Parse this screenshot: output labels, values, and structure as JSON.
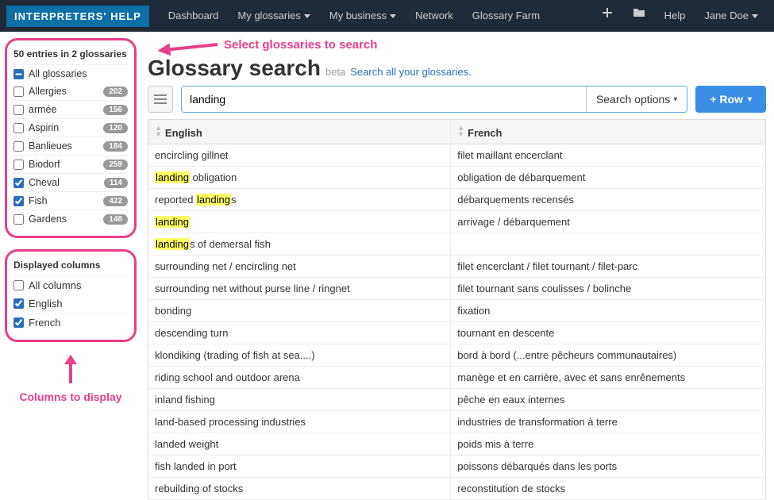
{
  "brand": "INTERPRETERS' HELP",
  "nav": {
    "dashboard": "Dashboard",
    "my_glossaries": "My glossaries",
    "my_business": "My business",
    "network": "Network",
    "glossary_farm": "Glossary Farm",
    "help": "Help",
    "user": "Jane Doe"
  },
  "annotations": {
    "select_glossaries": "Select glossaries to search",
    "columns_to_display": "Columns to display"
  },
  "sidebar": {
    "entries_head": "50 entries in 2 glossaries",
    "all_glossaries": "All glossaries",
    "glossaries": [
      {
        "label": "Allergies",
        "count": "202",
        "checked": false
      },
      {
        "label": "armée",
        "count": "156",
        "checked": false
      },
      {
        "label": "Aspirin",
        "count": "120",
        "checked": false
      },
      {
        "label": "Banlieues",
        "count": "184",
        "checked": false
      },
      {
        "label": "Biodorf",
        "count": "259",
        "checked": false
      },
      {
        "label": "Cheval",
        "count": "114",
        "checked": true
      },
      {
        "label": "Fish",
        "count": "422",
        "checked": true
      },
      {
        "label": "Gardens",
        "count": "148",
        "checked": false
      }
    ],
    "columns_head": "Displayed columns",
    "all_columns": "All columns",
    "columns": [
      {
        "label": "English",
        "checked": true
      },
      {
        "label": "French",
        "checked": true
      }
    ]
  },
  "main": {
    "title": "Glossary search",
    "beta": "beta",
    "title_link": "Search all your glossaries.",
    "search_value": "landing",
    "search_options": "Search options",
    "row_btn": "+ Row",
    "col_english": "English",
    "col_french": "French",
    "rows": [
      {
        "en_pre": "encircling gillnet",
        "en_hl": "",
        "en_post": "",
        "fr": "filet maillant encerclant"
      },
      {
        "en_pre": "",
        "en_hl": "landing",
        "en_post": " obligation",
        "fr": "obligation de débarquement"
      },
      {
        "en_pre": "reported ",
        "en_hl": "landing",
        "en_post": "s",
        "fr": "débarquements recensés"
      },
      {
        "en_pre": "",
        "en_hl": "landing",
        "en_post": "",
        "fr": "arrivage / débarquement"
      },
      {
        "en_pre": "",
        "en_hl": "landing",
        "en_post": "s of demersal fish",
        "fr": ""
      },
      {
        "en_pre": "surrounding net / encircling net",
        "en_hl": "",
        "en_post": "",
        "fr": "filet encerclant / filet tournant / filet-parc"
      },
      {
        "en_pre": "surrounding net without purse line / ringnet",
        "en_hl": "",
        "en_post": "",
        "fr": "filet tournant sans coulisses / bolinche"
      },
      {
        "en_pre": "bonding",
        "en_hl": "",
        "en_post": "",
        "fr": "fixation"
      },
      {
        "en_pre": "descending turn",
        "en_hl": "",
        "en_post": "",
        "fr": "tournant en descente"
      },
      {
        "en_pre": "klondiking (trading of fish at sea....)",
        "en_hl": "",
        "en_post": "",
        "fr": "bord à bord (...entre pêcheurs communautaires)"
      },
      {
        "en_pre": "riding school and outdoor arena",
        "en_hl": "",
        "en_post": "",
        "fr": "manège et en carrière, avec et sans enrênements"
      },
      {
        "en_pre": "inland fishing",
        "en_hl": "",
        "en_post": "",
        "fr": "pêche en eaux internes"
      },
      {
        "en_pre": "land-based processing industries",
        "en_hl": "",
        "en_post": "",
        "fr": "industries de transformation à terre"
      },
      {
        "en_pre": "landed weight",
        "en_hl": "",
        "en_post": "",
        "fr": "poids mis à terre"
      },
      {
        "en_pre": "fish landed in port",
        "en_hl": "",
        "en_post": "",
        "fr": "poissons débarqués dans les ports"
      },
      {
        "en_pre": "rebuilding of stocks",
        "en_hl": "",
        "en_post": "",
        "fr": "reconstitution de stocks"
      }
    ]
  },
  "colors": {
    "accent": "#3b8ee6",
    "annot": "#e83e8c"
  }
}
